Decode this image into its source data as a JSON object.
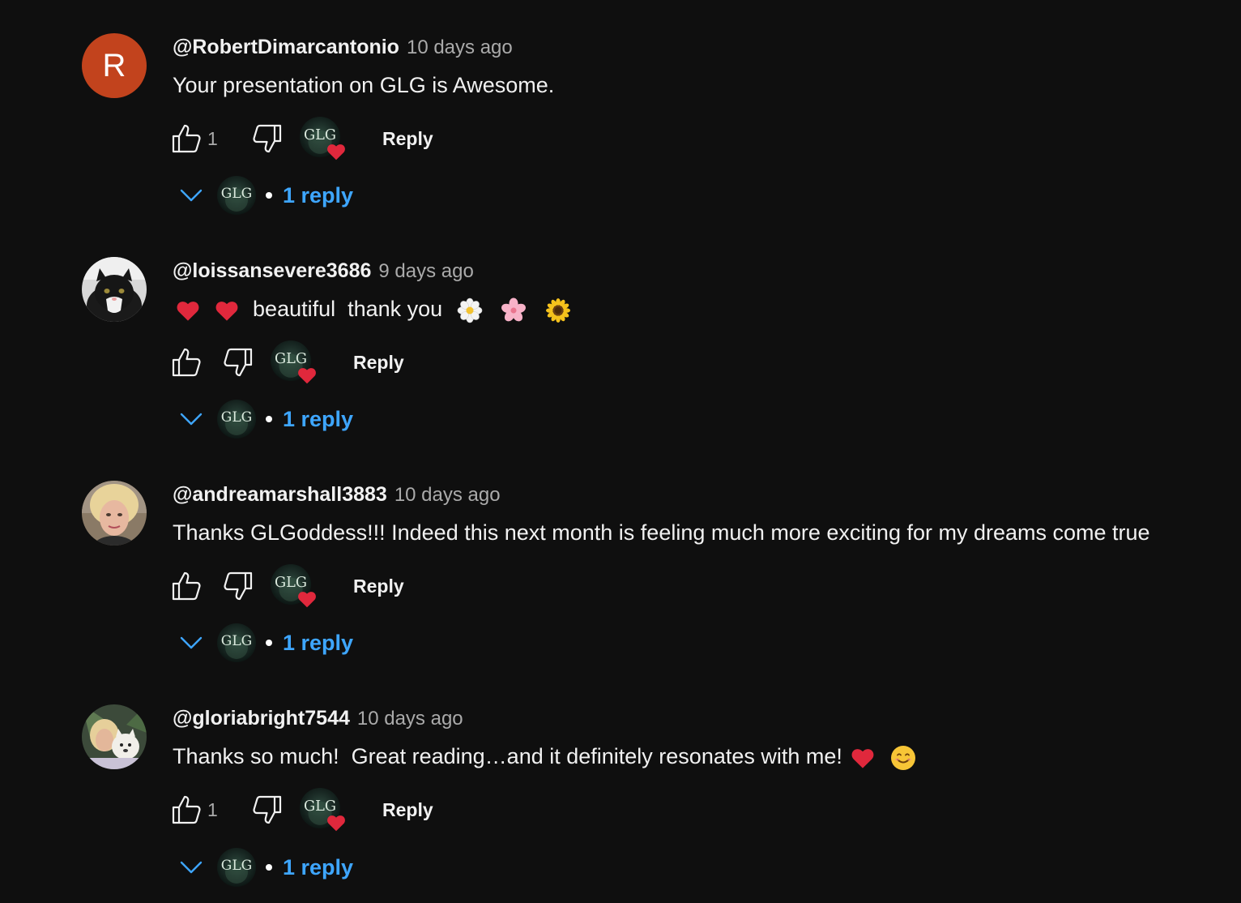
{
  "comments": [
    {
      "author": "@RobertDimarcantonio",
      "time": "10 days ago",
      "avatar_letter": "R",
      "avatar_color": "#c2431d",
      "text": "Your presentation on GLG is Awesome.",
      "likes": "1",
      "reply_label": "Reply",
      "replies_label": "1 reply",
      "creator_badge_text": "GLG"
    },
    {
      "author": "@loissansevere3686",
      "time": "9 days ago",
      "text_emoji_prefix": [
        "red-heart",
        "red-heart"
      ],
      "text": "beautiful  thank you",
      "text_emoji_suffix": [
        "white-flower",
        "cherry-blossom",
        "sunflower"
      ],
      "likes": "",
      "reply_label": "Reply",
      "replies_label": "1 reply",
      "creator_badge_text": "GLG"
    },
    {
      "author": "@andreamarshall3883",
      "time": "10 days ago",
      "text": "Thanks GLGoddess!!! Indeed this next month is feeling much more exciting for my dreams come true",
      "likes": "",
      "reply_label": "Reply",
      "replies_label": "1 reply",
      "creator_badge_text": "GLG"
    },
    {
      "author": "@gloriabright7544",
      "time": "10 days ago",
      "text": "Thanks so much!  Great reading…and it definitely resonates with me!",
      "text_emoji_suffix": [
        "red-heart",
        "smiling-face"
      ],
      "likes": "1",
      "reply_label": "Reply",
      "replies_label": "1 reply",
      "creator_badge_text": "GLG"
    }
  ],
  "colors": {
    "background": "#0f0f0f",
    "text": "#f1f1f1",
    "secondary_text": "#aaaaaa",
    "link_blue": "#3ea6ff",
    "heart_red": "#e0283c"
  }
}
